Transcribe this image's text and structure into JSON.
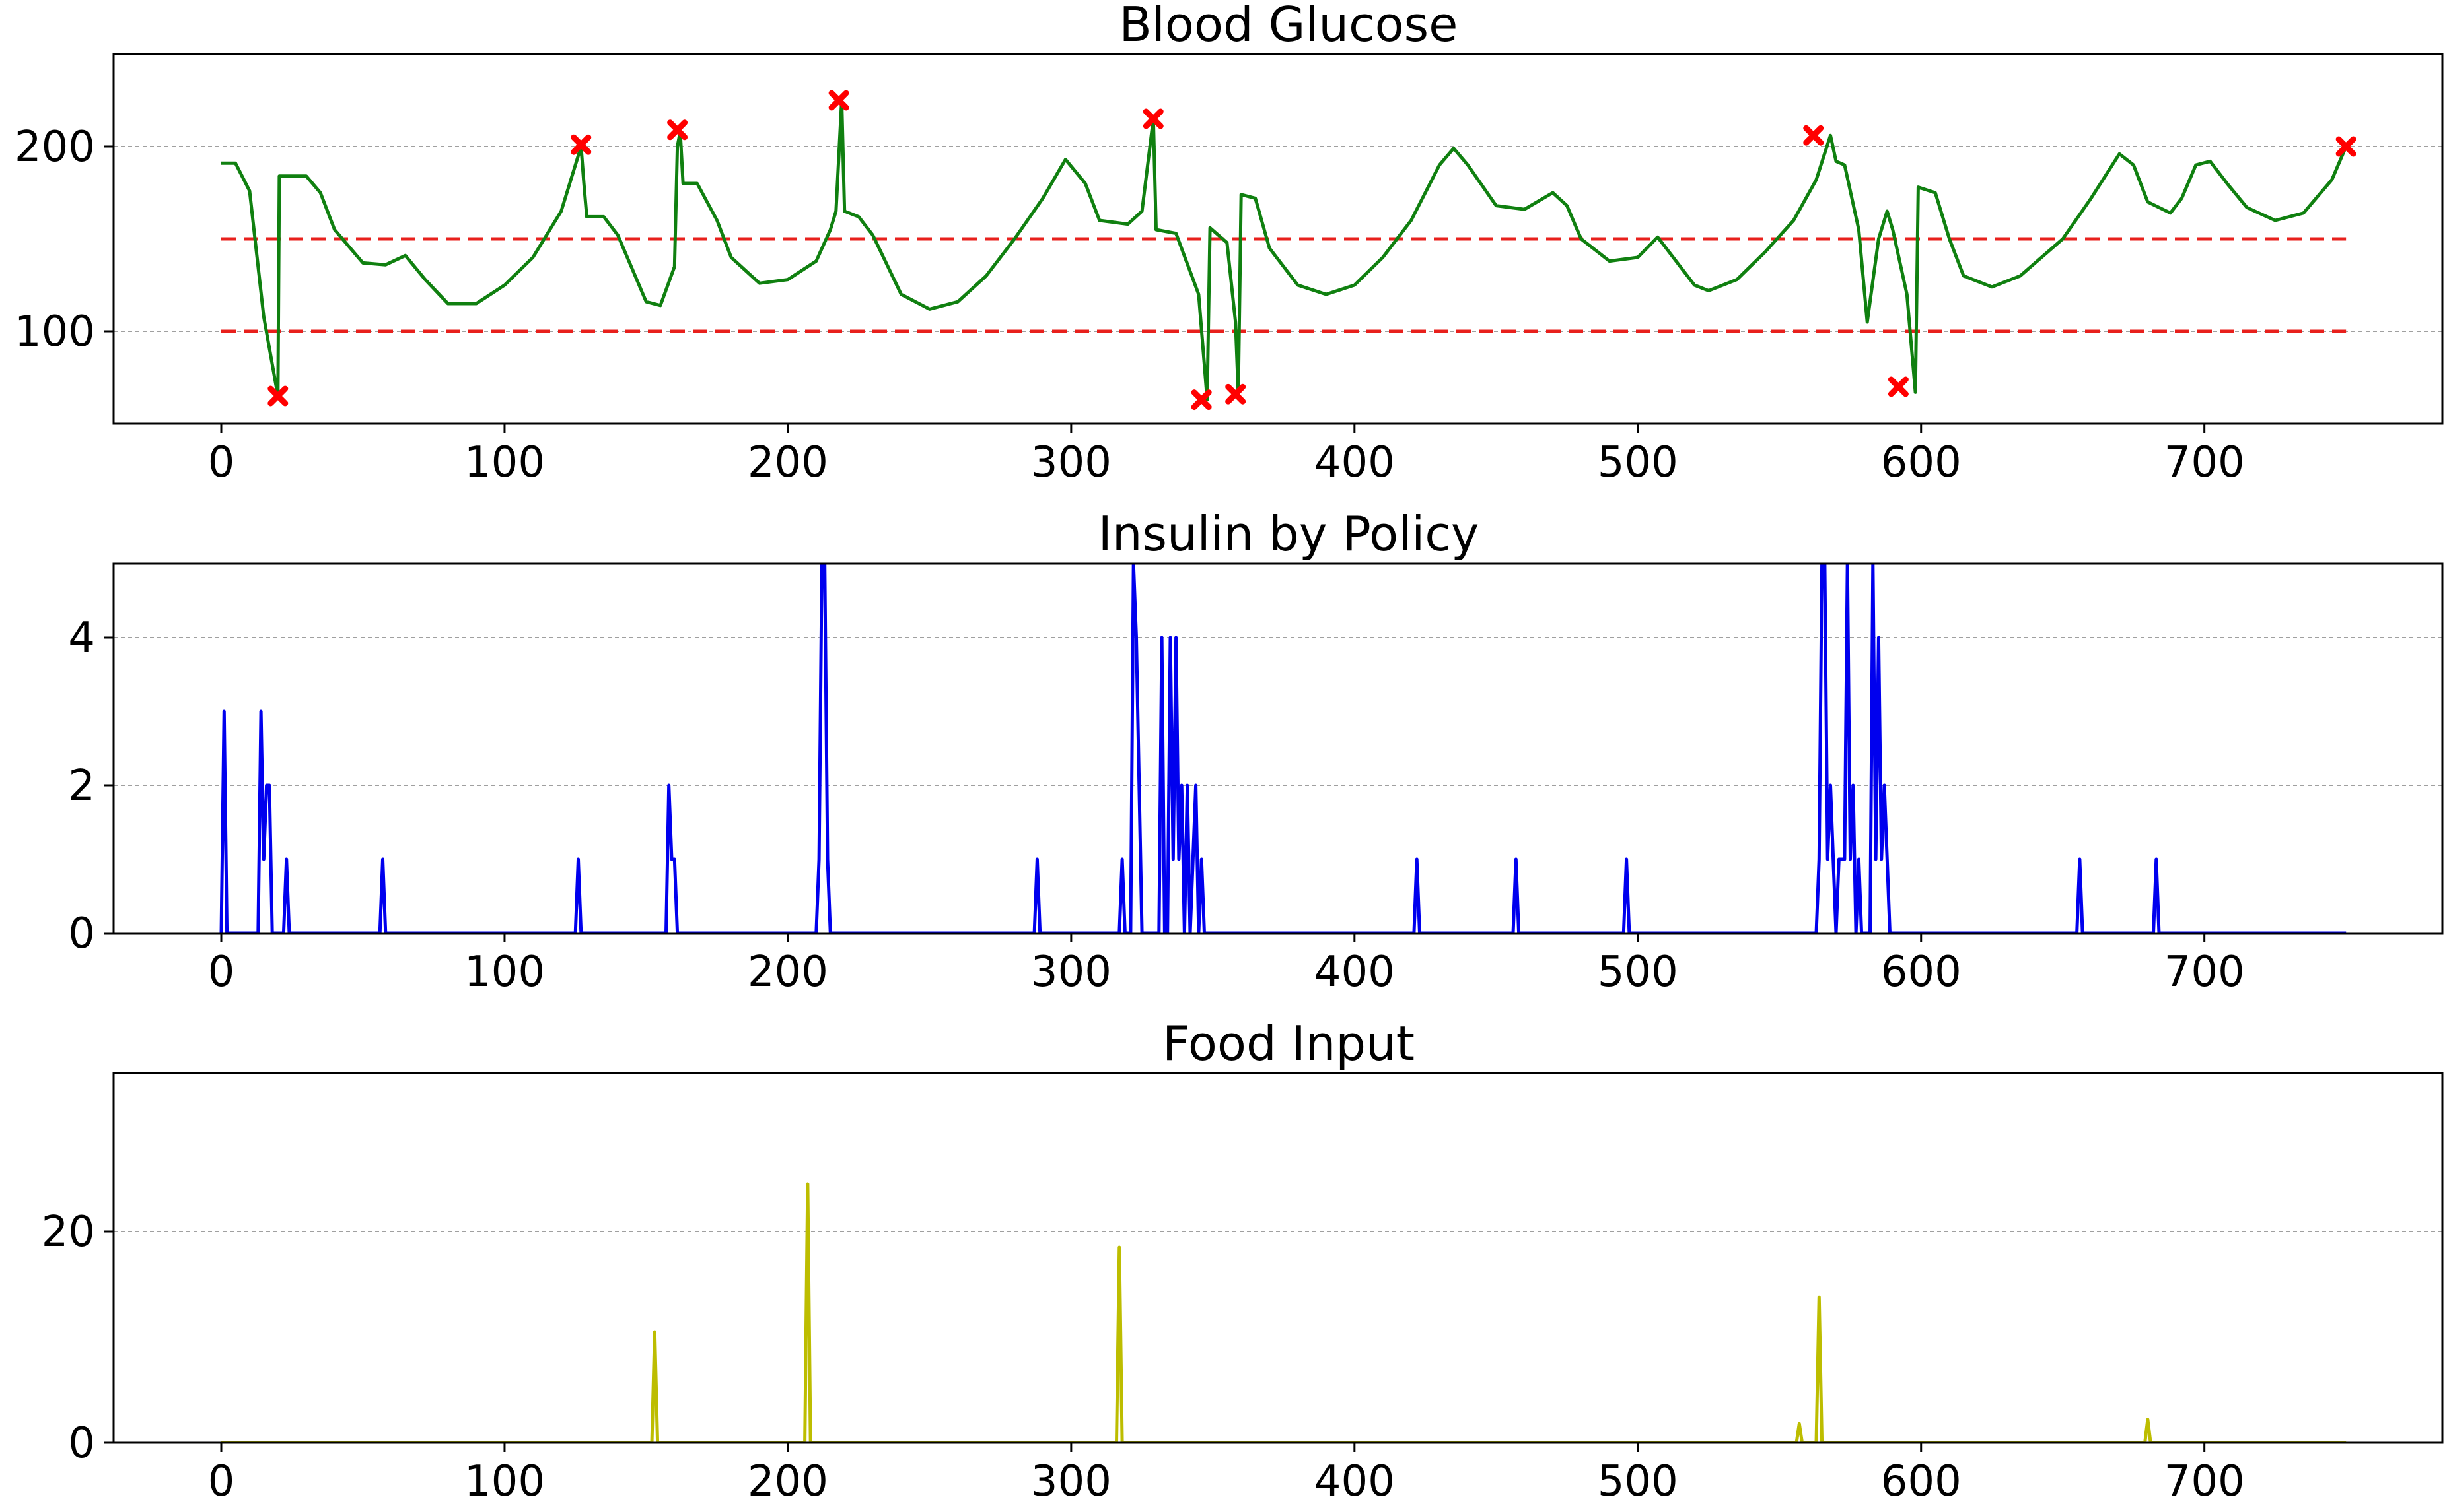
{
  "chart_data": [
    {
      "type": "line",
      "title": "Blood Glucose",
      "xlabel": "",
      "ylabel": "",
      "xlim": [
        -38,
        784
      ],
      "ylim": [
        50,
        250
      ],
      "xticks": [
        0,
        100,
        200,
        300,
        400,
        500,
        600,
        700
      ],
      "yticks": [
        100,
        200
      ],
      "grid": "horizontal dashed at y ticks",
      "reference_lines": [
        {
          "y": 150,
          "x_range": [
            0,
            750
          ],
          "color": "#e8201c",
          "style": "dashed"
        },
        {
          "y": 100,
          "x_range": [
            0,
            750
          ],
          "color": "#e8201c",
          "style": "dashed"
        }
      ],
      "series": [
        {
          "color": "#108010",
          "points": [
            [
              0,
              191
            ],
            [
              5,
              191
            ],
            [
              10,
              176
            ],
            [
              15,
              108
            ],
            [
              20,
              65
            ],
            [
              20.5,
              184
            ],
            [
              30,
              184
            ],
            [
              35,
              175
            ],
            [
              40,
              155
            ],
            [
              50,
              137
            ],
            [
              58,
              136
            ],
            [
              65,
              141
            ],
            [
              72,
              128
            ],
            [
              80,
              115
            ],
            [
              90,
              115
            ],
            [
              100,
              125
            ],
            [
              110,
              140
            ],
            [
              120,
              165
            ],
            [
              127,
              200
            ],
            [
              128,
              180
            ],
            [
              129,
              162
            ],
            [
              135,
              162
            ],
            [
              140,
              152
            ],
            [
              150,
              116
            ],
            [
              155,
              114
            ],
            [
              160,
              135
            ],
            [
              161,
              200
            ],
            [
              162,
              208
            ],
            [
              163,
              180
            ],
            [
              168,
              180
            ],
            [
              175,
              160
            ],
            [
              180,
              140
            ],
            [
              190,
              126
            ],
            [
              200,
              128
            ],
            [
              210,
              138
            ],
            [
              215,
              155
            ],
            [
              217,
              165
            ],
            [
              219,
              225
            ],
            [
              220,
              165
            ],
            [
              225,
              162
            ],
            [
              230,
              152
            ],
            [
              240,
              120
            ],
            [
              250,
              112
            ],
            [
              260,
              116
            ],
            [
              270,
              130
            ],
            [
              280,
              150
            ],
            [
              290,
              172
            ],
            [
              298,
              193
            ],
            [
              305,
              180
            ],
            [
              310,
              160
            ],
            [
              320,
              158
            ],
            [
              325,
              165
            ],
            [
              329,
              215
            ],
            [
              330,
              155
            ],
            [
              337,
              153
            ],
            [
              345,
              120
            ],
            [
              348,
              63
            ],
            [
              349,
              156
            ],
            [
              355,
              148
            ],
            [
              358,
              105
            ],
            [
              359,
              66
            ],
            [
              360,
              174
            ],
            [
              365,
              172
            ],
            [
              370,
              145
            ],
            [
              380,
              125
            ],
            [
              390,
              120
            ],
            [
              400,
              125
            ],
            [
              410,
              140
            ],
            [
              420,
              160
            ],
            [
              430,
              190
            ],
            [
              435,
              199
            ],
            [
              440,
              190
            ],
            [
              450,
              168
            ],
            [
              460,
              166
            ],
            [
              470,
              175
            ],
            [
              475,
              168
            ],
            [
              480,
              150
            ],
            [
              490,
              138
            ],
            [
              500,
              140
            ],
            [
              507,
              151
            ],
            [
              510,
              145
            ],
            [
              520,
              125
            ],
            [
              525,
              122
            ],
            [
              535,
              128
            ],
            [
              545,
              143
            ],
            [
              555,
              160
            ],
            [
              563,
              182
            ],
            [
              568,
              206
            ],
            [
              570,
              192
            ],
            [
              573,
              190
            ],
            [
              578,
              155
            ],
            [
              581,
              105
            ],
            [
              585,
              150
            ],
            [
              588,
              165
            ],
            [
              590,
              155
            ],
            [
              595,
              120
            ],
            [
              598,
              67
            ],
            [
              599,
              178
            ],
            [
              605,
              175
            ],
            [
              610,
              150
            ],
            [
              615,
              130
            ],
            [
              625,
              124
            ],
            [
              635,
              130
            ],
            [
              650,
              150
            ],
            [
              660,
              172
            ],
            [
              670,
              196
            ],
            [
              675,
              190
            ],
            [
              680,
              170
            ],
            [
              688,
              164
            ],
            [
              692,
              172
            ],
            [
              697,
              190
            ],
            [
              702,
              192
            ],
            [
              708,
              180
            ],
            [
              715,
              167
            ],
            [
              725,
              160
            ],
            [
              735,
              164
            ],
            [
              745,
              182
            ],
            [
              750,
              200
            ]
          ]
        }
      ],
      "markers": {
        "color": "#ff0000",
        "symbol": "x",
        "points": [
          [
            20,
            65
          ],
          [
            127,
            201
          ],
          [
            161,
            209
          ],
          [
            218,
            225
          ],
          [
            329,
            215
          ],
          [
            346,
            63
          ],
          [
            358,
            66
          ],
          [
            562,
            206
          ],
          [
            592,
            70
          ],
          [
            750,
            200
          ]
        ]
      }
    },
    {
      "type": "line",
      "title": "Insulin by Policy",
      "xlabel": "",
      "ylabel": "",
      "xlim": [
        -38,
        784
      ],
      "ylim": [
        0,
        5
      ],
      "xticks": [
        0,
        100,
        200,
        300,
        400,
        500,
        600,
        700
      ],
      "yticks": [
        0,
        2,
        4
      ],
      "grid": "horizontal dashed at y ticks",
      "series": [
        {
          "color": "#0000ee",
          "points": [
            [
              0,
              0
            ],
            [
              1,
              3
            ],
            [
              2,
              0
            ],
            [
              13,
              0
            ],
            [
              14,
              3
            ],
            [
              15,
              1
            ],
            [
              16,
              2
            ],
            [
              17,
              2
            ],
            [
              18,
              0
            ],
            [
              22,
              0
            ],
            [
              23,
              1
            ],
            [
              24,
              0
            ],
            [
              56,
              0
            ],
            [
              57,
              1
            ],
            [
              58,
              0
            ],
            [
              125,
              0
            ],
            [
              126,
              1
            ],
            [
              127,
              0
            ],
            [
              157,
              0
            ],
            [
              158,
              2
            ],
            [
              159,
              1
            ],
            [
              160,
              1
            ],
            [
              161,
              0
            ],
            [
              210,
              0
            ],
            [
              211,
              1
            ],
            [
              212,
              5
            ],
            [
              213,
              5
            ],
            [
              214,
              1
            ],
            [
              215,
              0
            ],
            [
              287,
              0
            ],
            [
              288,
              1
            ],
            [
              289,
              0
            ],
            [
              317,
              0
            ],
            [
              318,
              1
            ],
            [
              319,
              0
            ],
            [
              321,
              0
            ],
            [
              322,
              5
            ],
            [
              323,
              4
            ],
            [
              324,
              2
            ],
            [
              325,
              0
            ],
            [
              331,
              0
            ],
            [
              332,
              4
            ],
            [
              333,
              0
            ],
            [
              334,
              0
            ],
            [
              335,
              4
            ],
            [
              336,
              1
            ],
            [
              337,
              4
            ],
            [
              338,
              1
            ],
            [
              339,
              2
            ],
            [
              340,
              0
            ],
            [
              341,
              2
            ],
            [
              342,
              0
            ],
            [
              343,
              1
            ],
            [
              344,
              2
            ],
            [
              345,
              0
            ],
            [
              346,
              1
            ],
            [
              347,
              0
            ],
            [
              421,
              0
            ],
            [
              422,
              1
            ],
            [
              423,
              0
            ],
            [
              456,
              0
            ],
            [
              457,
              1
            ],
            [
              458,
              0
            ],
            [
              495,
              0
            ],
            [
              496,
              1
            ],
            [
              497,
              0
            ],
            [
              563,
              0
            ],
            [
              564,
              1
            ],
            [
              565,
              5
            ],
            [
              566,
              5
            ],
            [
              567,
              1
            ],
            [
              568,
              2
            ],
            [
              569,
              1
            ],
            [
              570,
              0
            ],
            [
              571,
              1
            ],
            [
              572,
              1
            ],
            [
              573,
              1
            ],
            [
              574,
              5
            ],
            [
              575,
              1
            ],
            [
              576,
              2
            ],
            [
              577,
              0
            ],
            [
              578,
              1
            ],
            [
              579,
              0
            ],
            [
              582,
              0
            ],
            [
              583,
              5
            ],
            [
              584,
              1
            ],
            [
              585,
              4
            ],
            [
              586,
              1
            ],
            [
              587,
              2
            ],
            [
              588,
              1
            ],
            [
              589,
              0
            ],
            [
              655,
              0
            ],
            [
              656,
              1
            ],
            [
              657,
              0
            ],
            [
              682,
              0
            ],
            [
              683,
              1
            ],
            [
              684,
              0
            ],
            [
              750,
              0
            ]
          ]
        }
      ]
    },
    {
      "type": "line",
      "title": "Food Input",
      "xlabel": "",
      "ylabel": "",
      "xlim": [
        -38,
        784
      ],
      "ylim": [
        0,
        35
      ],
      "xticks": [
        0,
        100,
        200,
        300,
        400,
        500,
        600,
        700
      ],
      "yticks": [
        0,
        20
      ],
      "grid": "horizontal dashed at y ticks",
      "series": [
        {
          "color": "#bdbd00",
          "points": [
            [
              0,
              0
            ],
            [
              152,
              0
            ],
            [
              153,
              10.5
            ],
            [
              154,
              0
            ],
            [
              206,
              0
            ],
            [
              207,
              24.5
            ],
            [
              208,
              0
            ],
            [
              316,
              0
            ],
            [
              317,
              18.5
            ],
            [
              318,
              0
            ],
            [
              556,
              0
            ],
            [
              557,
              1.8
            ],
            [
              558,
              0
            ],
            [
              563,
              0
            ],
            [
              564,
              13.8
            ],
            [
              565,
              0
            ],
            [
              679,
              0
            ],
            [
              680,
              2.2
            ],
            [
              681,
              0
            ],
            [
              750,
              0
            ]
          ]
        }
      ]
    }
  ]
}
